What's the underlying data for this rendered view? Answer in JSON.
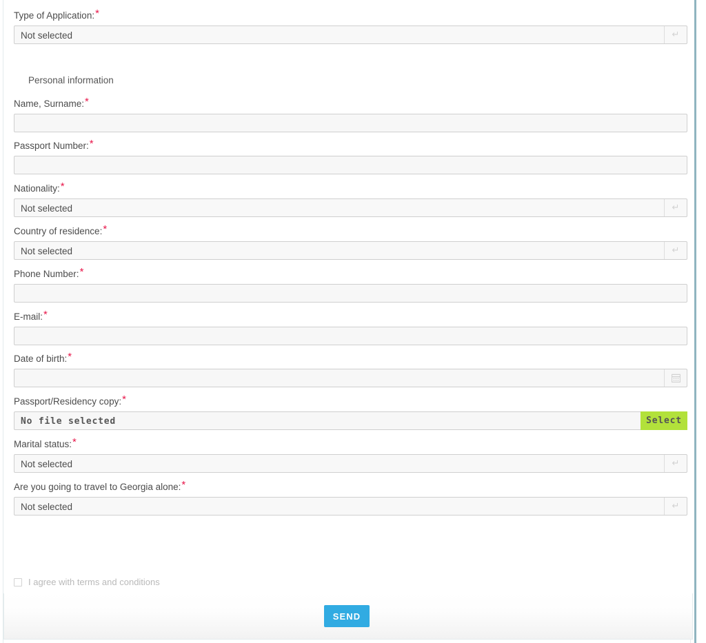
{
  "colors": {
    "required_marker": "#e8174a",
    "select_button": "#b2e13b",
    "send_button": "#31abe2",
    "field_background": "#f8f8f8",
    "field_border": "#cfcfcf",
    "label_text": "#4b4b4b"
  },
  "form": {
    "application_type": {
      "label": "Type of Application:",
      "required_marker": "*",
      "value": "Not selected",
      "control": "select",
      "icon": "dropdown-arrow-icon"
    },
    "section_title": "Personal information",
    "fields": [
      {
        "label": "Name, Surname:",
        "required_marker": "*",
        "value": "",
        "control": "text"
      },
      {
        "label": "Passport Number:",
        "required_marker": "*",
        "value": "",
        "control": "text"
      },
      {
        "label": "Nationality:",
        "required_marker": "*",
        "value": "Not selected",
        "control": "select",
        "icon": "dropdown-arrow-icon"
      },
      {
        "label": "Country of residence:",
        "required_marker": "*",
        "value": "Not selected",
        "control": "select",
        "icon": "dropdown-arrow-icon"
      },
      {
        "label": "Phone Number:",
        "required_marker": "*",
        "value": "",
        "control": "text"
      },
      {
        "label": "E-mail:",
        "required_marker": "*",
        "value": "",
        "control": "text"
      },
      {
        "label": "Date of birth:",
        "required_marker": "*",
        "value": "",
        "control": "date",
        "icon": "calendar-icon"
      }
    ],
    "file_upload": {
      "label": "Passport/Residency copy:",
      "required_marker": "*",
      "file_name": "No file selected",
      "button_label": "Select"
    },
    "trailing_fields": [
      {
        "label": "Marital status:",
        "required_marker": "*",
        "value": "Not selected",
        "control": "select",
        "icon": "dropdown-arrow-icon"
      },
      {
        "label": "Are you going to travel to Georgia alone:",
        "required_marker": "*",
        "value": "Not selected",
        "control": "select",
        "icon": "dropdown-arrow-icon"
      }
    ],
    "terms": {
      "label": "I agree with terms and conditions",
      "checked": false
    },
    "submit": {
      "label": "SEND"
    }
  },
  "icons": {
    "dropdown_arrow": "↵",
    "calendar": "calendar-icon"
  }
}
